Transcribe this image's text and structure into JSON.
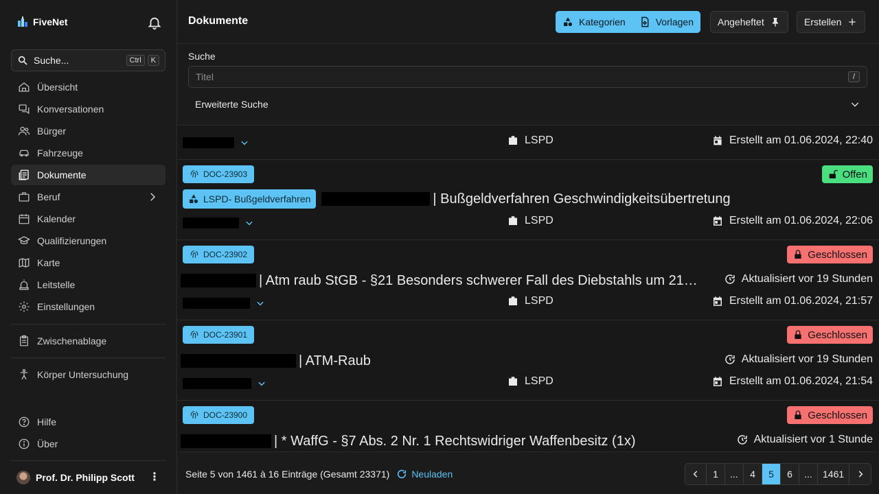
{
  "app": {
    "name": "FiveNet"
  },
  "sidebar": {
    "search": {
      "label": "Suche...",
      "kbd1": "Ctrl",
      "kbd2": "K"
    },
    "items": [
      {
        "label": "Übersicht",
        "icon": "home-icon"
      },
      {
        "label": "Konversationen",
        "icon": "chat-icon"
      },
      {
        "label": "Bürger",
        "icon": "users-icon"
      },
      {
        "label": "Fahrzeuge",
        "icon": "car-icon"
      },
      {
        "label": "Dokumente",
        "icon": "documents-icon"
      },
      {
        "label": "Beruf",
        "icon": "briefcase-icon"
      },
      {
        "label": "Kalender",
        "icon": "calendar-icon"
      },
      {
        "label": "Qualifizierungen",
        "icon": "graduation-icon"
      },
      {
        "label": "Karte",
        "icon": "map-icon"
      },
      {
        "label": "Leitstelle",
        "icon": "dispatch-icon"
      },
      {
        "label": "Einstellungen",
        "icon": "settings-icon"
      }
    ],
    "clipboard": "Zwischenablage",
    "body_check": "Körper Untersuchung",
    "help": "Hilfe",
    "about": "Über",
    "user": "Prof. Dr. Philipp Scott"
  },
  "header": {
    "title": "Dokumente",
    "categories": "Kategorien",
    "templates": "Vorlagen",
    "pinned": "Angeheftet",
    "create": "Erstellen"
  },
  "search_panel": {
    "label": "Suche",
    "placeholder": "Titel",
    "shortcut": "/",
    "advanced": "Erweiterte Suche"
  },
  "documents": {
    "partial": {
      "org": "LSPD",
      "created": "Erstellt am 01.06.2024, 22:40"
    },
    "rows": [
      {
        "id": "DOC-23903",
        "state": "Offen",
        "category": "LSPD- Bußgeldverfahren",
        "title": "| Bußgeldverfahren Geschwindigkeitsübertretung",
        "updated": "",
        "org": "LSPD",
        "created": "Erstellt am 01.06.2024, 22:06"
      },
      {
        "id": "DOC-23902",
        "state": "Geschlossen",
        "category": "",
        "title": "| Atm raub StGB - §21 Besonders schwerer Fall des Diebstahls um 21…",
        "updated": "Aktualisiert vor 19 Stunden",
        "org": "LSPD",
        "created": "Erstellt am 01.06.2024, 21:57"
      },
      {
        "id": "DOC-23901",
        "state": "Geschlossen",
        "category": "",
        "title": "| ATM-Raub",
        "updated": "Aktualisiert vor 19 Stunden",
        "org": "LSPD",
        "created": "Erstellt am 01.06.2024, 21:54"
      },
      {
        "id": "DOC-23900",
        "state": "Geschlossen",
        "category": "",
        "title": "| * WaffG - §7 Abs. 2 Nr. 1 Rechtswidriger Waffenbesitz (1x)",
        "updated": "Aktualisiert vor 1 Stunde",
        "org": "",
        "created": ""
      }
    ]
  },
  "footer": {
    "info": "Seite 5 von 1461 à 16 Einträge (Gesamt 23371)",
    "reload": "Neuladen",
    "pages": [
      "1",
      "...",
      "4",
      "5",
      "6",
      "...",
      "1461"
    ],
    "current_page": "5"
  },
  "colors": {
    "accent": "#5cc3f4",
    "open": "#4ade80",
    "closed": "#f87171"
  }
}
